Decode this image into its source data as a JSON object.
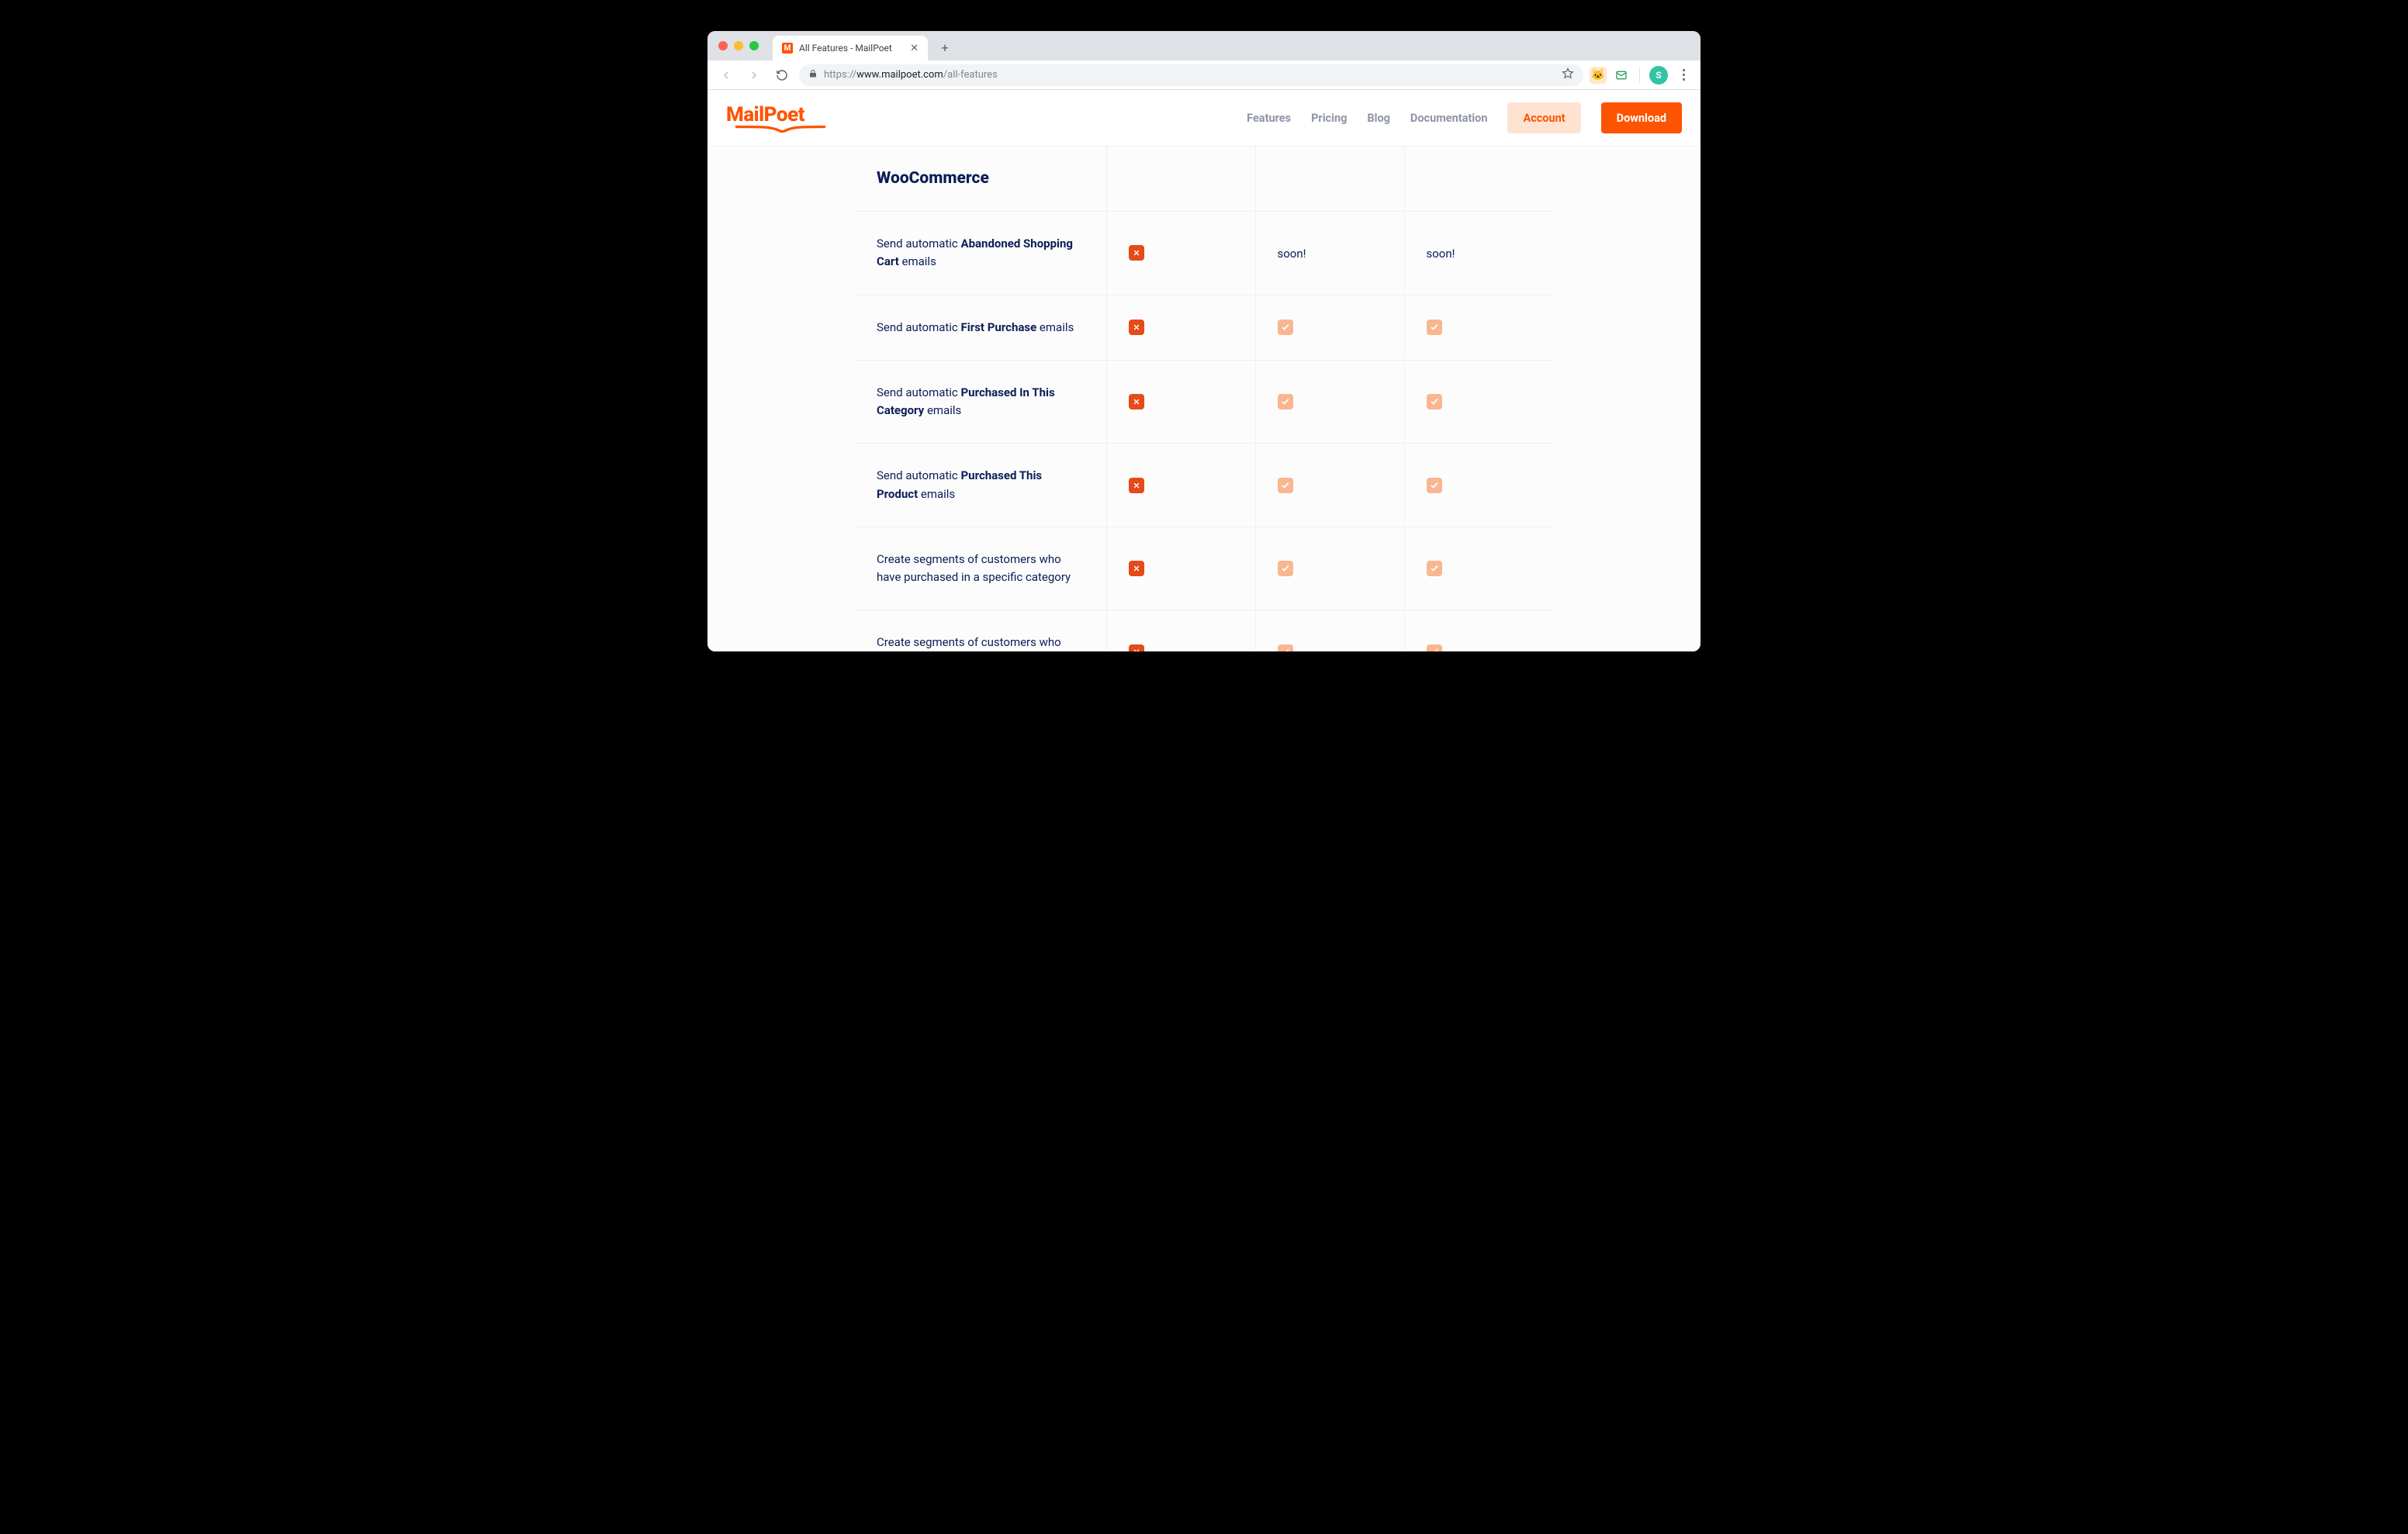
{
  "browser": {
    "tab_title": "All Features - MailPoet",
    "url_scheme": "https://",
    "url_host": "www.mailpoet.com",
    "url_path": "/all-features",
    "avatar_letter": "S"
  },
  "header": {
    "logo_text": "MailPoet",
    "nav": {
      "features": "Features",
      "pricing": "Pricing",
      "blog": "Blog",
      "docs": "Documentation",
      "account": "Account",
      "download": "Download"
    }
  },
  "table": {
    "section_title": "WooCommerce",
    "soon_text": "soon!",
    "rows": [
      {
        "label_pre": "Send automatic ",
        "label_bold": "Abandoned Shopping Cart",
        "label_post": " emails",
        "cells": [
          "no",
          "soon",
          "soon"
        ]
      },
      {
        "label_pre": "Send automatic ",
        "label_bold": "First Purchase",
        "label_post": " emails",
        "cells": [
          "no",
          "yes",
          "yes"
        ]
      },
      {
        "label_pre": "Send automatic ",
        "label_bold": "Purchased In This Category",
        "label_post": " emails",
        "cells": [
          "no",
          "yes",
          "yes"
        ]
      },
      {
        "label_pre": "Send automatic ",
        "label_bold": "Purchased This Product",
        "label_post": " emails",
        "cells": [
          "no",
          "yes",
          "yes"
        ]
      },
      {
        "label_pre": "Create segments of customers who have purchased in a specific category",
        "label_bold": "",
        "label_post": "",
        "cells": [
          "no",
          "yes",
          "yes"
        ]
      },
      {
        "label_pre": "Create segments of customers who have purchased a specific product",
        "label_bold": "",
        "label_post": "",
        "cells": [
          "no",
          "yes",
          "yes"
        ]
      }
    ]
  }
}
